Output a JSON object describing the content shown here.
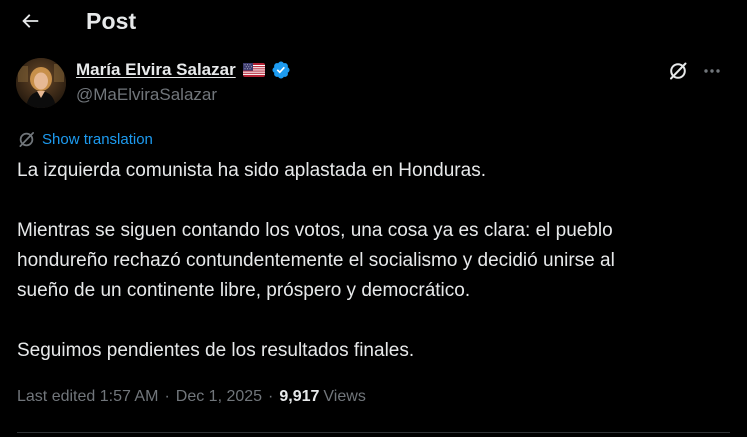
{
  "header": {
    "title": "Post",
    "back_icon": "arrow-left-icon"
  },
  "author": {
    "name": "María Elvira Salazar",
    "handle": "@MaElviraSalazar",
    "flag_icon": "us-flag-icon",
    "verified_icon": "verified-badge-icon",
    "verified_color": "#1d9bf0"
  },
  "actions": {
    "grok_icon": "grok-icon",
    "more_icon": "more-icon"
  },
  "translation": {
    "label": "Show translation",
    "icon": "translate-icon"
  },
  "tweet": {
    "paragraphs": [
      "La izquierda comunista ha sido aplastada en Honduras.",
      "Mientras se siguen contando los votos, una cosa ya es clara: el pueblo\nhondureño rechazó contundentemente el socialismo y decidió unirse al\nsueño de un continente libre, próspero y democrático.",
      "Seguimos pendientes de los resultados finales."
    ]
  },
  "meta": {
    "edited": "Last edited 1:57 AM",
    "separator": "·",
    "date": "Dec 1, 2025",
    "views_count": "9,917",
    "views_label": "Views"
  },
  "colors": {
    "background": "#000000",
    "text": "#e7e9ea",
    "secondary": "#71767b",
    "accent": "#1d9bf0",
    "border": "#2f3336"
  }
}
